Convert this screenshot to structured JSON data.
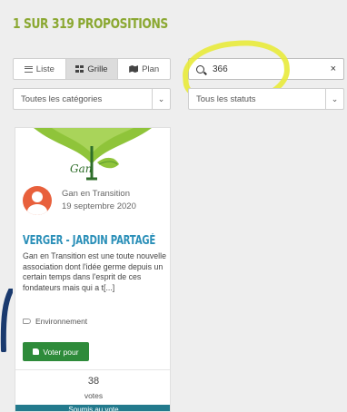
{
  "results": {
    "title": "1 SUR 319 PROPOSITIONS"
  },
  "view_toggle": {
    "list_label": "Liste",
    "grid_label": "Grille",
    "map_label": "Plan",
    "active": "grid"
  },
  "search": {
    "value": "366",
    "clear_symbol": "×",
    "highlight_color": "#e8ea3a"
  },
  "filters": {
    "category": {
      "selected": "Toutes les catégories"
    },
    "status": {
      "selected": "Tous les statuts"
    }
  },
  "card": {
    "image_caption": "Gan",
    "author": {
      "name": "Gan en Transition",
      "date": "19 septembre 2020"
    },
    "title": "VERGER - JARDIN PARTAGÉ",
    "excerpt": "Gan en Transition est une toute nouvelle association dont l'idée germe depuis un certain temps dans l'esprit de ces fondateurs mais qui a t[...]",
    "tag": "Environnement",
    "vote_button": "Voter pour",
    "votes_count": "38",
    "votes_label": "votes",
    "status": "Soumis au vote"
  },
  "colors": {
    "title": "#8ba832",
    "link": "#2a8fb8",
    "vote_button": "#2e8b3a",
    "status_bar": "#237a8d",
    "avatar": "#e8603c"
  }
}
